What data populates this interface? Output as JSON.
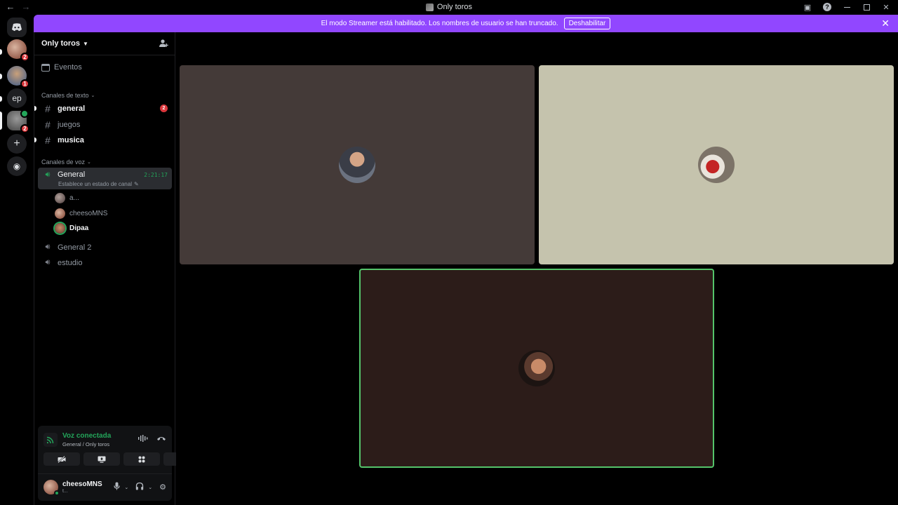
{
  "window": {
    "title": "Only toros"
  },
  "banner": {
    "message": "El modo Streamer está habilitado. Los nombres de usuario se han truncado.",
    "button_label": "Deshabilitar"
  },
  "servers": {
    "ep_label": "ep",
    "badges": [
      "2",
      "1",
      "2"
    ]
  },
  "guild": {
    "name": "Only toros"
  },
  "sidebar": {
    "events_label": "Eventos",
    "text_category": "Canales de texto",
    "text_channels": [
      {
        "name": "general",
        "badge": "2"
      },
      {
        "name": "juegos"
      },
      {
        "name": "musica"
      }
    ],
    "voice_category": "Canales de voz",
    "voice_channels": [
      {
        "name": "General",
        "timer": "2:21:17",
        "status": "Establece un estado de canal"
      },
      {
        "name": "General 2"
      },
      {
        "name": "estudio"
      }
    ],
    "voice_users": [
      {
        "name": "a..."
      },
      {
        "name": "cheesoMNS"
      },
      {
        "name": "Dipaa"
      }
    ]
  },
  "voice_panel": {
    "title": "Voz conectada",
    "subtitle": "General / Only toros"
  },
  "user": {
    "name": "cheesoMNS",
    "status": "t..."
  },
  "colors": {
    "banner": "#9147ff",
    "connected_green": "#23a55a",
    "badge_red": "#da373c",
    "speaking_border": "#54c46a"
  }
}
